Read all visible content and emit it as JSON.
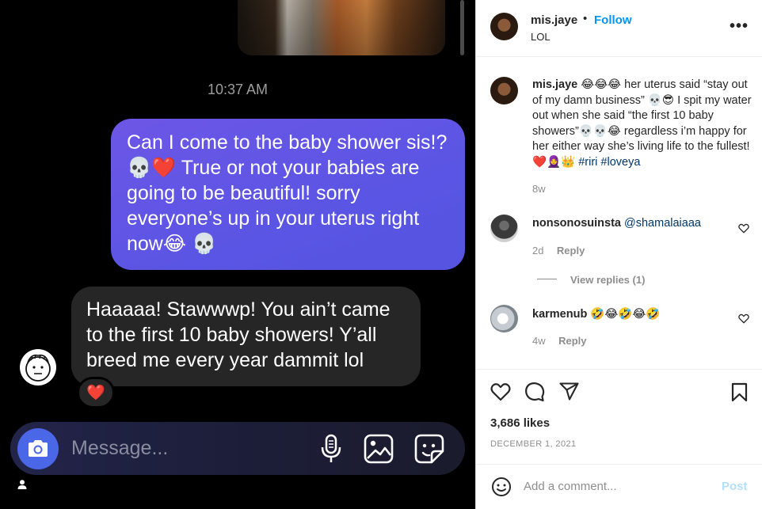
{
  "chat": {
    "timestamp": "10:37 AM",
    "outgoing_message": "Can I come to the baby shower sis!?💀❤️ True or not your babies are going to be beautiful! sorry everyone’s up in your uterus right now😂 💀",
    "incoming_message": "Haaaaa! Stawwwp! You ain’t came to the first 10 baby showers! Y’all breed me every year dammit lol",
    "reaction": "❤️",
    "composer_placeholder": "Message...",
    "icons": [
      "camera-icon",
      "microphone-icon",
      "gallery-icon",
      "sticker-icon"
    ]
  },
  "post": {
    "username": "mis.jaye",
    "dot": "•",
    "follow_label": "Follow",
    "subtitle": "LOL",
    "more_label": "•••",
    "caption": {
      "username": "mis.jaye",
      "text": " 😂😂😂 her uterus said “stay out of my damn business” 💀😎 I spit my water out when she said “the first 10 baby showers”💀💀😂 regardless i’m happy for her either way she’s living life to the fullest! ❤️🧕👑 ",
      "hashtag1": "#riri",
      "hashtag2": "#loveya",
      "time": "8w"
    },
    "comments": [
      {
        "username": "nonsonosuinsta",
        "mention": "@shamalaiaaa",
        "time": "2d",
        "reply_label": "Reply",
        "view_replies": "View replies (1)"
      },
      {
        "username": "karmenub",
        "text": "🤣😂🤣😂🤣",
        "time": "4w",
        "reply_label": "Reply"
      }
    ],
    "likes": "3,686 likes",
    "date": "DECEMBER 1, 2021",
    "add_comment_placeholder": "Add a comment...",
    "post_label": "Post"
  },
  "colors": {
    "outgoing_bubble": "#5b55e4",
    "incoming_bubble": "#262626",
    "camera_button": "#4a67e8",
    "follow": "#0095f6",
    "post_disabled": "#b2dffc"
  }
}
